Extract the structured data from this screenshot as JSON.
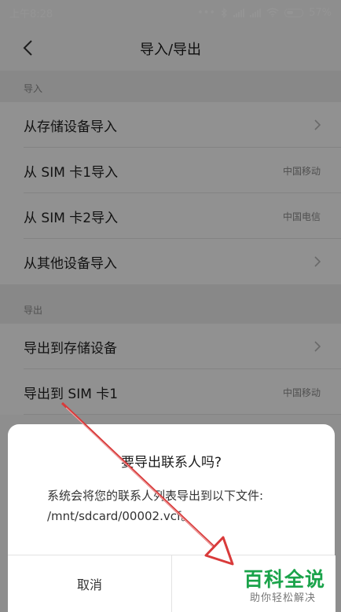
{
  "status_bar": {
    "time": "上午8:28",
    "battery": "57%"
  },
  "header": {
    "title": "导入/导出"
  },
  "import_section": {
    "label": "导入",
    "items": [
      {
        "label": "从存储设备导入",
        "meta": ""
      },
      {
        "label": "从 SIM 卡1导入",
        "meta": "中国移动"
      },
      {
        "label": "从 SIM 卡2导入",
        "meta": "中国电信"
      },
      {
        "label": "从其他设备导入",
        "meta": ""
      }
    ]
  },
  "export_section": {
    "label": "导出",
    "items": [
      {
        "label": "导出到存储设备",
        "meta": ""
      },
      {
        "label": "导出到 SIM 卡1",
        "meta": "中国移动"
      }
    ]
  },
  "dialog": {
    "title": "要导出联系人吗?",
    "message": "系统会将您的联系人列表导出到以下文件: /mnt/sdcard/00002.vcf。",
    "cancel_label": "取消",
    "confirm_label": ""
  },
  "watermark": {
    "title": "百科全说",
    "subtitle": "助你轻松解决",
    "color": "#1aa34a"
  },
  "colors": {
    "annotation_arrow": "#d93a3a"
  }
}
